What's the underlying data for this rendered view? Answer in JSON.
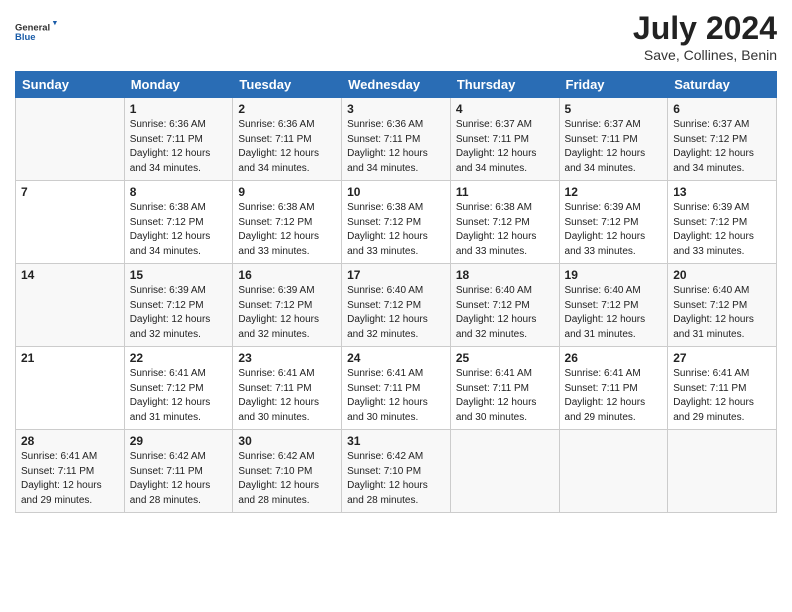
{
  "header": {
    "logo_general": "General",
    "logo_blue": "Blue",
    "month_year": "July 2024",
    "location": "Save, Collines, Benin"
  },
  "days_of_week": [
    "Sunday",
    "Monday",
    "Tuesday",
    "Wednesday",
    "Thursday",
    "Friday",
    "Saturday"
  ],
  "weeks": [
    [
      {
        "day": "",
        "info": ""
      },
      {
        "day": "1",
        "info": "Sunrise: 6:36 AM\nSunset: 7:11 PM\nDaylight: 12 hours\nand 34 minutes."
      },
      {
        "day": "2",
        "info": "Sunrise: 6:36 AM\nSunset: 7:11 PM\nDaylight: 12 hours\nand 34 minutes."
      },
      {
        "day": "3",
        "info": "Sunrise: 6:36 AM\nSunset: 7:11 PM\nDaylight: 12 hours\nand 34 minutes."
      },
      {
        "day": "4",
        "info": "Sunrise: 6:37 AM\nSunset: 7:11 PM\nDaylight: 12 hours\nand 34 minutes."
      },
      {
        "day": "5",
        "info": "Sunrise: 6:37 AM\nSunset: 7:11 PM\nDaylight: 12 hours\nand 34 minutes."
      },
      {
        "day": "6",
        "info": "Sunrise: 6:37 AM\nSunset: 7:12 PM\nDaylight: 12 hours\nand 34 minutes."
      }
    ],
    [
      {
        "day": "7",
        "info": ""
      },
      {
        "day": "8",
        "info": "Sunrise: 6:38 AM\nSunset: 7:12 PM\nDaylight: 12 hours\nand 34 minutes."
      },
      {
        "day": "9",
        "info": "Sunrise: 6:38 AM\nSunset: 7:12 PM\nDaylight: 12 hours\nand 33 minutes."
      },
      {
        "day": "10",
        "info": "Sunrise: 6:38 AM\nSunset: 7:12 PM\nDaylight: 12 hours\nand 33 minutes."
      },
      {
        "day": "11",
        "info": "Sunrise: 6:38 AM\nSunset: 7:12 PM\nDaylight: 12 hours\nand 33 minutes."
      },
      {
        "day": "12",
        "info": "Sunrise: 6:39 AM\nSunset: 7:12 PM\nDaylight: 12 hours\nand 33 minutes."
      },
      {
        "day": "13",
        "info": "Sunrise: 6:39 AM\nSunset: 7:12 PM\nDaylight: 12 hours\nand 33 minutes."
      }
    ],
    [
      {
        "day": "14",
        "info": ""
      },
      {
        "day": "15",
        "info": "Sunrise: 6:39 AM\nSunset: 7:12 PM\nDaylight: 12 hours\nand 32 minutes."
      },
      {
        "day": "16",
        "info": "Sunrise: 6:39 AM\nSunset: 7:12 PM\nDaylight: 12 hours\nand 32 minutes."
      },
      {
        "day": "17",
        "info": "Sunrise: 6:40 AM\nSunset: 7:12 PM\nDaylight: 12 hours\nand 32 minutes."
      },
      {
        "day": "18",
        "info": "Sunrise: 6:40 AM\nSunset: 7:12 PM\nDaylight: 12 hours\nand 32 minutes."
      },
      {
        "day": "19",
        "info": "Sunrise: 6:40 AM\nSunset: 7:12 PM\nDaylight: 12 hours\nand 31 minutes."
      },
      {
        "day": "20",
        "info": "Sunrise: 6:40 AM\nSunset: 7:12 PM\nDaylight: 12 hours\nand 31 minutes."
      }
    ],
    [
      {
        "day": "21",
        "info": ""
      },
      {
        "day": "22",
        "info": "Sunrise: 6:41 AM\nSunset: 7:12 PM\nDaylight: 12 hours\nand 31 minutes."
      },
      {
        "day": "23",
        "info": "Sunrise: 6:41 AM\nSunset: 7:11 PM\nDaylight: 12 hours\nand 30 minutes."
      },
      {
        "day": "24",
        "info": "Sunrise: 6:41 AM\nSunset: 7:11 PM\nDaylight: 12 hours\nand 30 minutes."
      },
      {
        "day": "25",
        "info": "Sunrise: 6:41 AM\nSunset: 7:11 PM\nDaylight: 12 hours\nand 30 minutes."
      },
      {
        "day": "26",
        "info": "Sunrise: 6:41 AM\nSunset: 7:11 PM\nDaylight: 12 hours\nand 29 minutes."
      },
      {
        "day": "27",
        "info": "Sunrise: 6:41 AM\nSunset: 7:11 PM\nDaylight: 12 hours\nand 29 minutes."
      }
    ],
    [
      {
        "day": "28",
        "info": "Sunrise: 6:41 AM\nSunset: 7:11 PM\nDaylight: 12 hours\nand 29 minutes."
      },
      {
        "day": "29",
        "info": "Sunrise: 6:42 AM\nSunset: 7:11 PM\nDaylight: 12 hours\nand 28 minutes."
      },
      {
        "day": "30",
        "info": "Sunrise: 6:42 AM\nSunset: 7:10 PM\nDaylight: 12 hours\nand 28 minutes."
      },
      {
        "day": "31",
        "info": "Sunrise: 6:42 AM\nSunset: 7:10 PM\nDaylight: 12 hours\nand 28 minutes."
      },
      {
        "day": "",
        "info": ""
      },
      {
        "day": "",
        "info": ""
      },
      {
        "day": "",
        "info": ""
      }
    ]
  ]
}
